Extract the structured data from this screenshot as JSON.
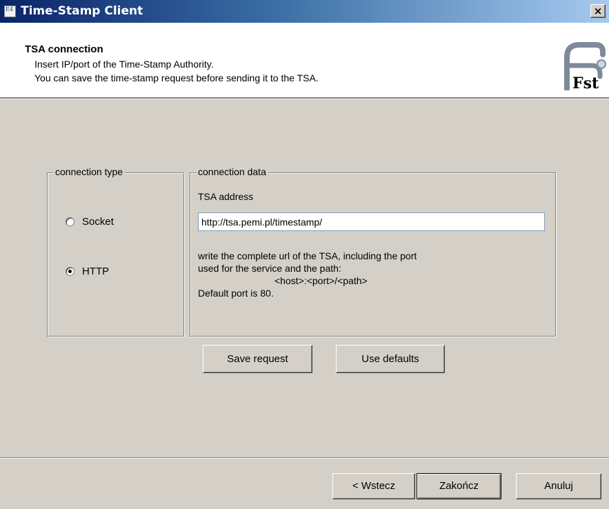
{
  "window": {
    "title": "Time-Stamp Client",
    "close_label": "×",
    "icon_label": "E4"
  },
  "header": {
    "title": "TSA connection",
    "line1": "Insert IP/port of the Time-Stamp Authority.",
    "line2": "You can save the time-stamp request before sending it to the TSA.",
    "logo_text": "Fst"
  },
  "connection_type": {
    "legend": "connection type",
    "options": [
      {
        "label": "Socket",
        "checked": false
      },
      {
        "label": "HTTP",
        "checked": true
      }
    ]
  },
  "connection_data": {
    "legend": "connection data",
    "address_label": "TSA address",
    "address_value": "http://tsa.pemi.pl/timestamp/",
    "help_line1": "write the complete url of the TSA, including the port",
    "help_line2": "used for the service and the path:",
    "help_line3": "<host>:<port>/<path>",
    "help_line4": "Default port is 80."
  },
  "actions": {
    "save_request": "Save request",
    "use_defaults": "Use defaults"
  },
  "footer": {
    "back": "< Wstecz",
    "finish": "Zakończ",
    "cancel": "Anuluj"
  }
}
